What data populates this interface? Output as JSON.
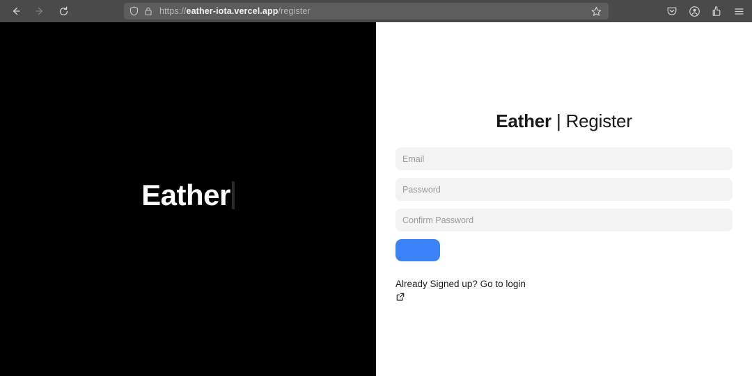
{
  "browser": {
    "nav": {
      "back_label": "Back",
      "forward_label": "Forward",
      "reload_label": "Reload"
    },
    "url": {
      "scheme": "https://",
      "host": "eather-iota.vercel.app",
      "path": "/register",
      "full": "https://eather-iota.vercel.app/register",
      "shield_icon": "shield-icon",
      "lock_icon": "lock-icon",
      "bookmark_icon": "star-icon"
    },
    "toolbar_icons": [
      "pocket-icon",
      "account-circle-icon",
      "extensions-icon",
      "hamburger-menu-icon"
    ]
  },
  "hero": {
    "brand": "Eather",
    "caret": ""
  },
  "form": {
    "title_brand": "Eather",
    "title_separator": " | ",
    "title_page": "Register",
    "fields": [
      {
        "name": "email",
        "placeholder": "Email",
        "value": "",
        "type": "text"
      },
      {
        "name": "password",
        "placeholder": "Password",
        "value": "",
        "type": "password"
      },
      {
        "name": "confirm_password",
        "placeholder": "Confirm Password",
        "value": "",
        "type": "password"
      }
    ],
    "submit_label": "",
    "login_prompt": "Already Signed up? Go to login",
    "login_icon": "external-link-icon"
  },
  "colors": {
    "accent_blue": "#3b82f6",
    "panel_black": "#000000",
    "field_bg": "#f3f3f3",
    "chrome_bg": "#4a4a4a",
    "urlbar_bg": "#5d5d5d"
  }
}
